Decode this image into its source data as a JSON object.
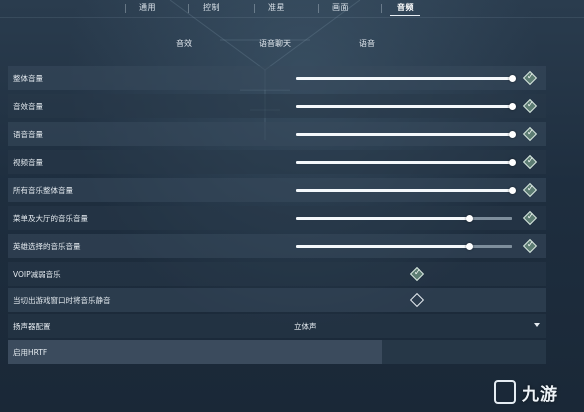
{
  "top_tabs": [
    {
      "label": "通用",
      "active": false
    },
    {
      "label": "控制",
      "active": false
    },
    {
      "label": "准星",
      "active": false
    },
    {
      "label": "画面",
      "active": false
    },
    {
      "label": "音频",
      "active": true
    }
  ],
  "sub_tabs": [
    {
      "label": "音效",
      "active": true
    },
    {
      "label": "语音聊天",
      "active": false
    },
    {
      "label": "语音",
      "active": false
    }
  ],
  "settings": [
    {
      "label": "整体音量",
      "type": "slider",
      "level": 1.0,
      "checked": true
    },
    {
      "label": "音效音量",
      "type": "slider",
      "level": 1.0,
      "checked": true
    },
    {
      "label": "语音音量",
      "type": "slider",
      "level": 1.0,
      "checked": true
    },
    {
      "label": "视频音量",
      "type": "slider",
      "level": 1.0,
      "checked": true
    },
    {
      "label": "所有音乐整体音量",
      "type": "slider",
      "level": 1.0,
      "checked": true
    },
    {
      "label": "菜单及大厅的音乐音量",
      "type": "slider",
      "level": 0.8,
      "checked": true
    },
    {
      "label": "英雄选择的音乐音量",
      "type": "slider",
      "level": 0.8,
      "checked": true
    },
    {
      "label": "VOIP减弱音乐",
      "type": "checkbox",
      "checked": true
    },
    {
      "label": "当切出游戏窗口时将音乐静音",
      "type": "checkbox",
      "checked": false
    },
    {
      "label": "扬声器配置",
      "type": "dropdown",
      "value": "立体声"
    },
    {
      "label": "启用HRTF",
      "type": "toggle"
    }
  ],
  "watermark": {
    "text": "九游",
    "icon": "jiuyou-logo-icon"
  },
  "colors": {
    "accent": "#5c7c72",
    "row_bg": "#384a5c",
    "background": "#1c2a3a"
  }
}
